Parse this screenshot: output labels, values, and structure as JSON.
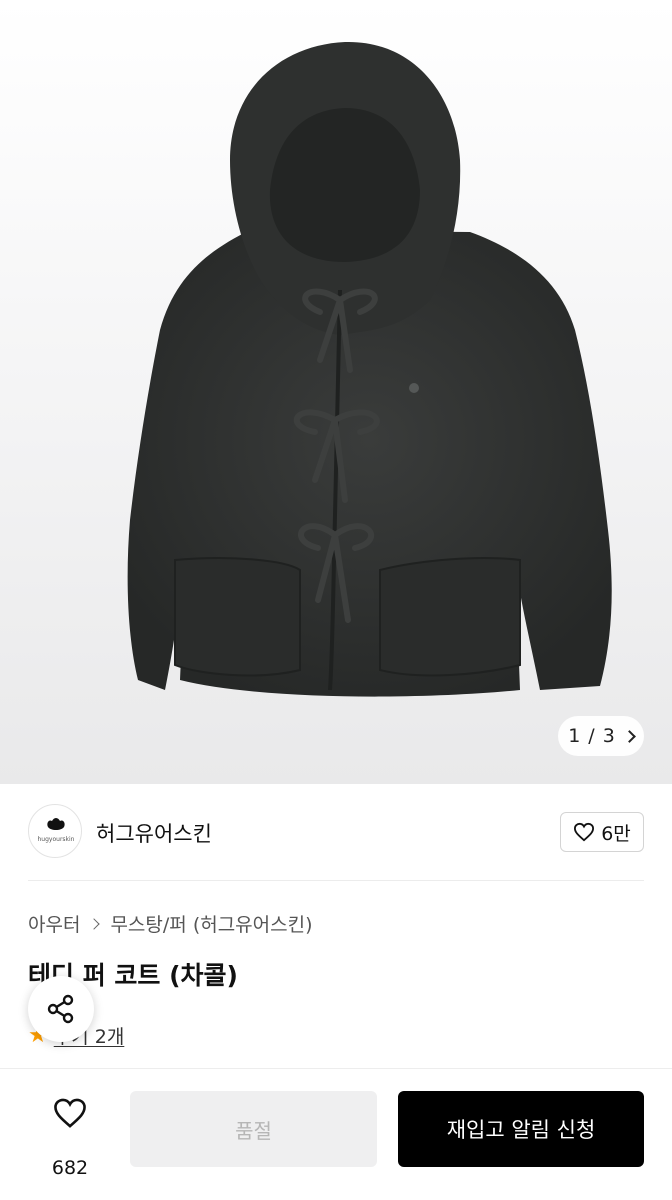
{
  "gallery": {
    "current": "1",
    "separator": "/",
    "total": "3",
    "image_alt": "teddy fur hooded coat, charcoal"
  },
  "brand": {
    "name": "허그유어스킨",
    "logo_text": "hugyourskin",
    "likes": "6만"
  },
  "breadcrumb": [
    "아우터",
    "무스탕/퍼 (허그유어스킨)"
  ],
  "product": {
    "title": "테디 퍼 코트 (차콜)",
    "review_label": "후기 2개"
  },
  "bottom": {
    "like_count": "682",
    "soldout_label": "품절",
    "restock_label": "재입고 알림 신청"
  },
  "colors": {
    "accent_star": "#ff9f00",
    "primary_button": "#000000",
    "disabled_button": "#efeff0",
    "coat": "#2d2f2e"
  }
}
